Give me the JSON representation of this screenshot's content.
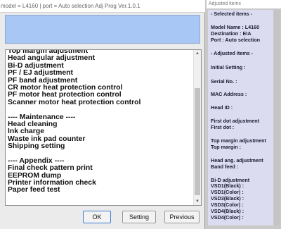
{
  "main_window": {
    "title": "model = L4160 | port = Auto selection  Adj Prog Ver.1.0.1",
    "list_items": [
      "Top margin adjustment",
      "Head angular adjustment",
      "Bi-D adjustment",
      "PF / EJ adjustment",
      "PF band adjustment",
      "CR motor heat protection control",
      "PF motor heat protection control",
      "Scanner motor heat protection control",
      "",
      "---- Maintenance ----",
      "Head cleaning",
      "Ink charge",
      "Waste ink pad counter",
      "Shipping setting",
      "",
      "---- Appendix ----",
      "Final check pattern print",
      "EEPROM dump",
      "Printer information check",
      "Paper feed test"
    ],
    "buttons": {
      "ok": "OK",
      "setting": "Setting",
      "previous": "Previous"
    }
  },
  "side_window": {
    "title": "Adjusted items",
    "selected_header": "- Selected items -",
    "model_name": "Model Name : L4160",
    "destination": "Destination : EIA",
    "port": "Port : Auto selection",
    "adjusted_header": "- Adjusted items -",
    "initial_setting": "Initial Setting :",
    "serial_no": "Serial No. :",
    "mac_address": "MAC Address :",
    "head_id": "Head ID :",
    "first_dot_adj": "First dot adjustment",
    "first_dot": "First dot :",
    "top_margin_adj": "Top margin adjustment",
    "top_margin": "Top margin :",
    "head_ang_adj": "Head ang. adjustment",
    "band_feed": "Band feed :",
    "bid_adj": "Bi-D adjustment",
    "vsd1_black": "VSD1(Black) :",
    "vsd1_color": "VSD1(Color) :",
    "vsd3_black": "VSD3(Black) :",
    "vsd3_color": "VSD3(Color) :",
    "vsd4_black": "VSD4(Black) :",
    "vsd4_color": "VSD4(Color) :"
  }
}
